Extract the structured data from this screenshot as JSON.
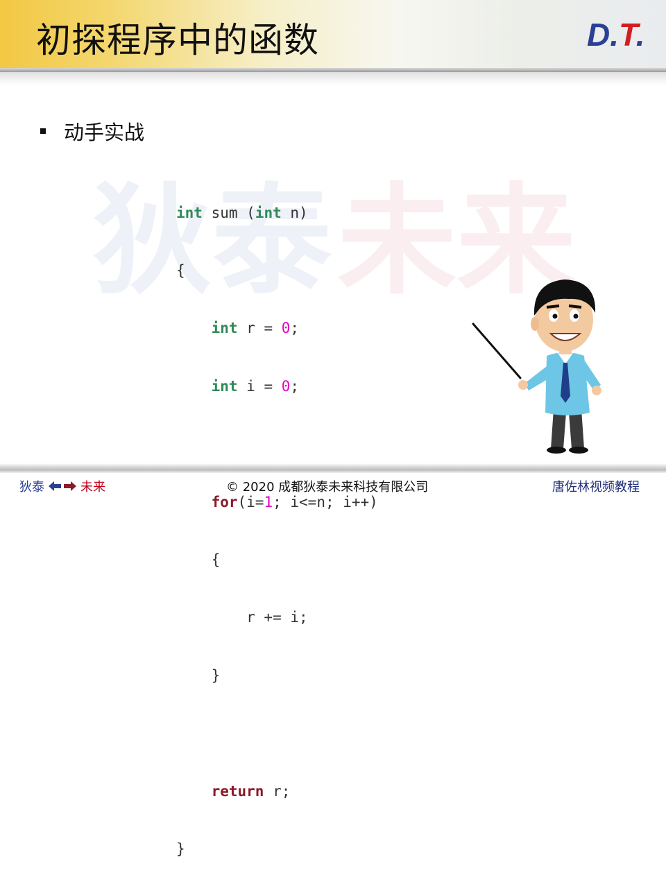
{
  "header": {
    "title": "初探程序中的函数",
    "logo": {
      "d": "D",
      "dot": ".",
      "t": "T",
      "dot2": "."
    }
  },
  "content": {
    "bullet": "动手实战",
    "watermark": {
      "left": "狄泰",
      "right": "未来"
    },
    "code": {
      "line1": {
        "kw": "int",
        "a": " sum (",
        "kw2": "int",
        "b": " n)"
      },
      "line2": "{",
      "line3": {
        "indent": "    ",
        "kw": "int",
        "a": " r = ",
        "num": "0",
        "b": ";"
      },
      "line4": {
        "indent": "    ",
        "kw": "int",
        "a": " i = ",
        "num": "0",
        "b": ";"
      },
      "line6": {
        "indent": "    ",
        "kw": "for",
        "a": "(i=",
        "num": "1",
        "b": "; i<=n; i++)"
      },
      "line7": "    {",
      "line8": "        r += i;",
      "line9": "    }",
      "line11": {
        "indent": "    ",
        "kw": "return",
        "a": " r;"
      },
      "line12": "}"
    }
  },
  "footer": {
    "left_a": "狄泰",
    "left_b": "未来",
    "center": "© 2020 成都狄泰未来科技有限公司",
    "right": "唐佐林视频教程"
  },
  "colors": {
    "keyword": "#2e8b57",
    "return_keyword": "#8b1a2a",
    "number": "#e000c0",
    "brand_blue": "#2a3f96",
    "brand_red": "#d21e23"
  },
  "icons": [
    "bullet-square-icon",
    "left-arrow-icon",
    "right-arrow-icon",
    "teacher-illustration"
  ]
}
